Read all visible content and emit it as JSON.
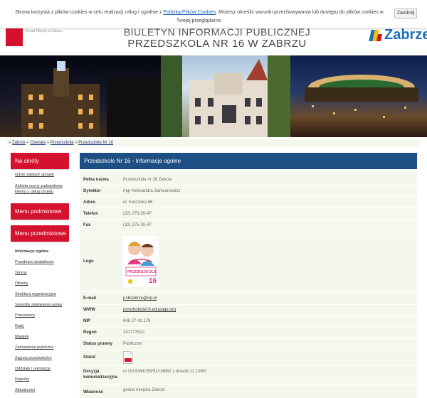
{
  "header": {
    "crest_text": "Urząd Miejski w Zabrzu",
    "title_line1": "BIULETYN INFORMACJI PUBLICZNEJ",
    "title_line2": "PRZEDSZKOLA NR 16 W ZABRZU",
    "logo_text": "Zabrze",
    "logo_colors": [
      "#1d70b8",
      "#f2c200",
      "#d4122d"
    ]
  },
  "cookie": {
    "text_before": "Strona korzysta z plików cookies w celu realizacji usług i zgodnie z ",
    "link": "Polityką Plików Cookies",
    "text_after": ". Możesz określić warunki przechowywania lub dostępu do plików cookies w Twojej przeglądarce.",
    "button": "Zamknij"
  },
  "breadcrumb": {
    "sep": "»",
    "items": [
      "Zabrze",
      "Oświata",
      "Przedszkola",
      "Przedszkole Nr 16"
    ]
  },
  "nav": {
    "na_skroty": "Na skróty",
    "shortcut_links": [
      "Gdzie załatwić sprawę",
      "Ankieta oceny zadowolenia klienta z usług Urzędu"
    ],
    "menu_podmiotowe": "Menu podmiotowe",
    "menu_przedmiotowe": "Menu przedmiotowe",
    "items": [
      "Informacje ogólne",
      "Przedmiot działalności",
      "Tereny",
      "Obiekty",
      "Struktura organizacyjna",
      "Sposoby załatwiania spraw",
      "Pracownicy",
      "Rady",
      "Majątek",
      "Zamówienia publiczne",
      "Zajęcia przedszkolne",
      "Oddziały i rekrutacja",
      "Rejestry",
      "Aktualności"
    ]
  },
  "content": {
    "title": "Przedszkole Nr 16  -  Informacje ogólne",
    "rows": [
      {
        "key": "Pełna nazwa",
        "value": "Przedszkole nr 16 Zabrze"
      },
      {
        "key": "Dyrektor",
        "value": "mgr Aleksandra Samsonowicz"
      },
      {
        "key": "Adres",
        "value": "ul. Korczoka 96"
      },
      {
        "key": "Telefon",
        "value": "(32) 275-30-47"
      },
      {
        "key": "Fax",
        "value": "(32) 275-30-47"
      },
      {
        "key": "Logo",
        "value": ""
      },
      {
        "key": "E-mail",
        "value": "p16zabrze@op.pl"
      },
      {
        "key": "WWW",
        "value": "przedszkole16.edupage.org"
      },
      {
        "key": "NIP",
        "value": "648 27 42 179"
      },
      {
        "key": "Regon",
        "value": "241777622"
      },
      {
        "key": "Status prawny",
        "value": "Publiczne"
      },
      {
        "key": "Statut",
        "value": ""
      },
      {
        "key": "Decyzja komunalizacyjna",
        "value": "nr GII-5/WK/55/91/U4882 z dnia16.12.1992r"
      },
      {
        "key": "Własność",
        "value": "gmina miejska Zabrze"
      }
    ],
    "school_logo_text": "PRZEDSZKOLE",
    "school_logo_number": "16"
  },
  "colors": {
    "accent_red": "#d4122d",
    "title_blue": "#1d4f84",
    "table_bg": "#f4f8ec"
  }
}
